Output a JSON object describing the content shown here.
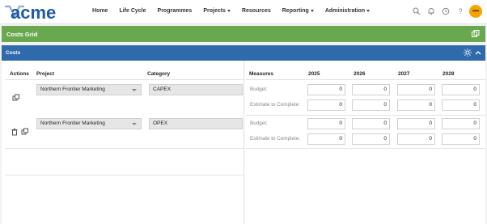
{
  "brand": {
    "logo_text": "acme"
  },
  "nav": {
    "items": [
      {
        "label": "Home",
        "dropdown": false
      },
      {
        "label": "Life Cycle",
        "dropdown": false
      },
      {
        "label": "Programmes",
        "dropdown": false
      },
      {
        "label": "Projects",
        "dropdown": true
      },
      {
        "label": "Resources",
        "dropdown": false
      },
      {
        "label": "Reporting",
        "dropdown": true
      },
      {
        "label": "Administration",
        "dropdown": true
      }
    ],
    "tools": [
      "search-icon",
      "bell-icon",
      "clock-icon",
      "help-icon"
    ],
    "help_label": "?",
    "avatar_text": "∞∞"
  },
  "section": {
    "title": "Costs Grid"
  },
  "panel": {
    "title": "Costs"
  },
  "grid": {
    "headers": {
      "actions": "Actions",
      "project": "Project",
      "category": "Category",
      "measures": "Measures",
      "years": [
        "2025",
        "2026",
        "2027",
        "2028"
      ]
    },
    "rows": [
      {
        "project": "Northern Frontier Marketing",
        "category": "CAPEX",
        "actions": [
          "copy-icon"
        ],
        "measures": [
          {
            "label": "Budget:",
            "values": [
              "0",
              "0",
              "0",
              "0"
            ]
          },
          {
            "label": "Estimate to Complete:",
            "values": [
              "0",
              "0",
              "0",
              "0"
            ]
          }
        ]
      },
      {
        "project": "Northern Frontier Marketing",
        "category": "OPEX",
        "actions": [
          "delete-icon",
          "copy-icon"
        ],
        "measures": [
          {
            "label": "Budget:",
            "values": [
              "0",
              "0",
              "0",
              "0"
            ]
          },
          {
            "label": "Estimate to Complete:",
            "values": [
              "0",
              "0",
              "0",
              "0"
            ]
          }
        ]
      }
    ]
  },
  "colors": {
    "green_bar": "#6aa84f",
    "blue_bar": "#2f6aad",
    "logo_blue": "#1f5aa6",
    "avatar": "#f5a400"
  }
}
